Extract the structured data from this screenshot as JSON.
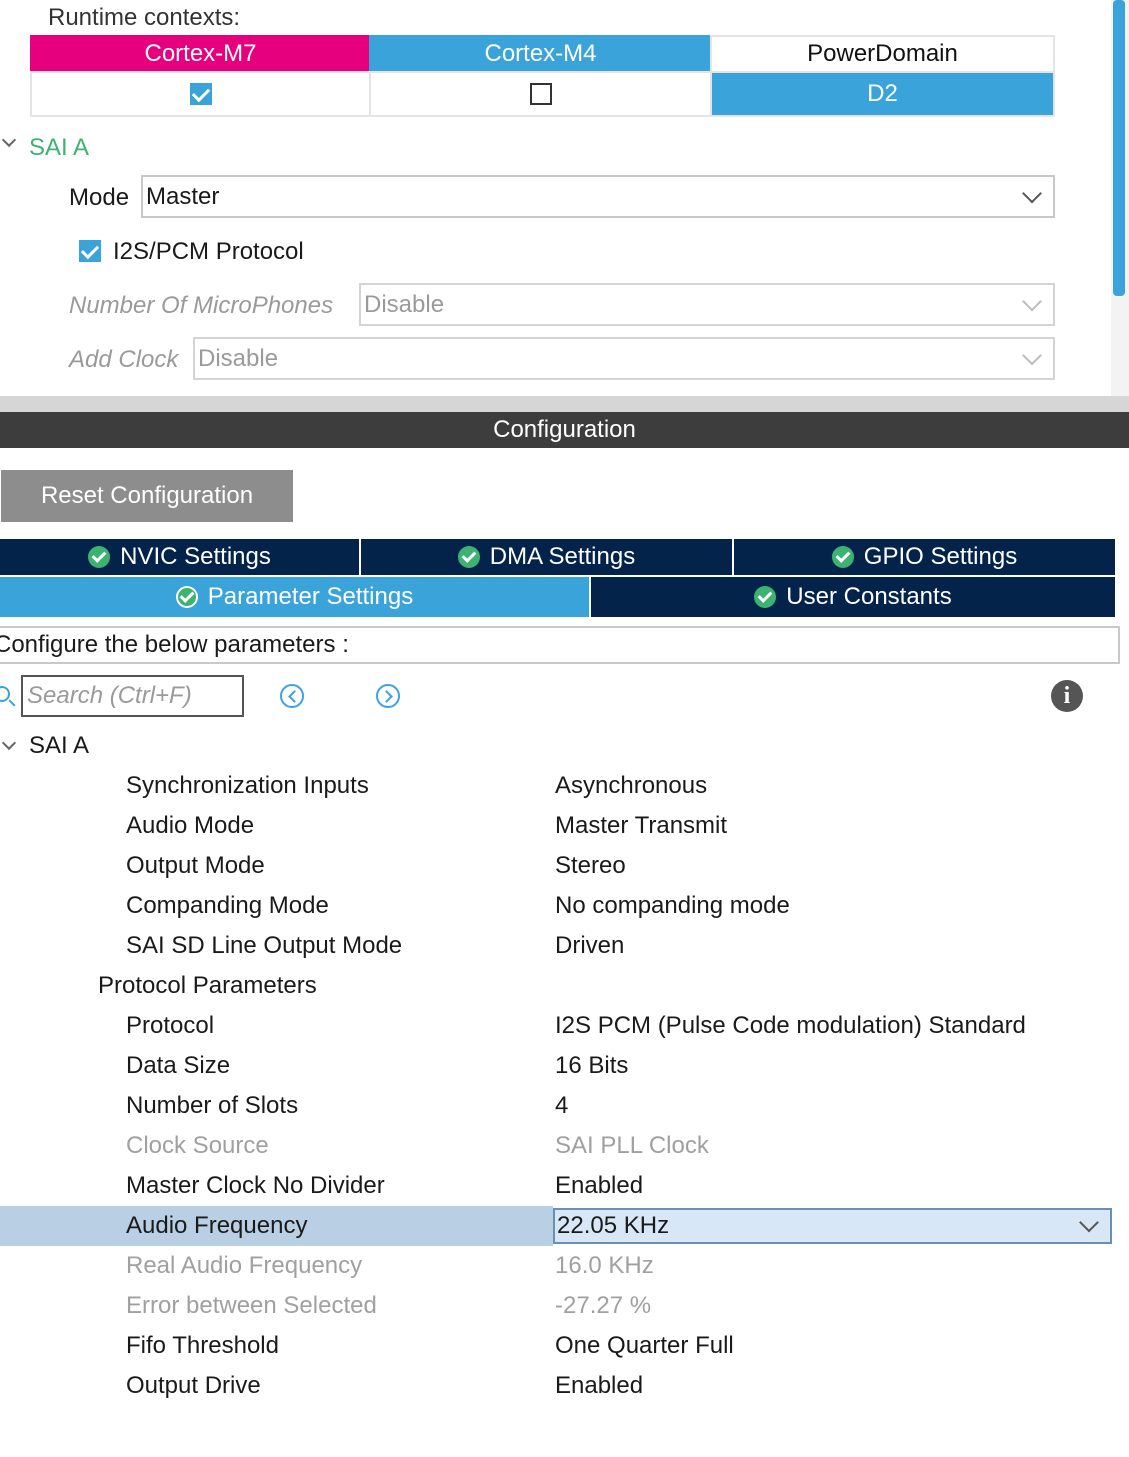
{
  "runtime": {
    "label": "Runtime contexts:",
    "columns": [
      {
        "name": "Cortex-M7",
        "checked": true,
        "color": "#e6007e"
      },
      {
        "name": "Cortex-M4",
        "checked": false,
        "color": "#3aa3d9"
      },
      {
        "name": "PowerDomain",
        "value": "D2"
      }
    ]
  },
  "sai_top": {
    "section": "SAI A",
    "mode_label": "Mode",
    "mode_value": "Master",
    "protocol_label": "I2S/PCM Protocol",
    "protocol_checked": true,
    "mics_label": "Number Of MicroPhones",
    "mics_value": "Disable",
    "clock_label": "Add Clock",
    "clock_value": "Disable"
  },
  "config": {
    "title": "Configuration",
    "reset_label": "Reset Configuration",
    "tabs": {
      "nvic": "NVIC Settings",
      "dma": "DMA Settings",
      "gpio": "GPIO Settings",
      "param": "Parameter Settings",
      "user": "User Constants"
    },
    "hint": "Configure the below parameters :",
    "search_placeholder": "Search (Ctrl+F)"
  },
  "params": {
    "section": "SAI A",
    "rows": [
      {
        "label": "Synchronization Inputs",
        "value": "Asynchronous"
      },
      {
        "label": "Audio Mode",
        "value": "Master Transmit"
      },
      {
        "label": "Output Mode",
        "value": "Stereo"
      },
      {
        "label": "Companding Mode",
        "value": "No companding mode"
      },
      {
        "label": "SAI SD Line Output Mode",
        "value": "Driven"
      },
      {
        "label": "Protocol Parameters",
        "value": ""
      },
      {
        "label": "Protocol",
        "value": "I2S PCM (Pulse Code modulation) Standard"
      },
      {
        "label": "Data Size",
        "value": "16 Bits"
      },
      {
        "label": "Number of Slots",
        "value": "4"
      },
      {
        "label": "Clock Source",
        "value": "SAI PLL Clock"
      },
      {
        "label": "Master Clock No Divider",
        "value": "Enabled"
      },
      {
        "label": "Audio Frequency",
        "value": "22.05 KHz"
      },
      {
        "label": "Real Audio Frequency",
        "value": "16.0 KHz"
      },
      {
        "label": "Error between Selected",
        "value": "-27.27 %"
      },
      {
        "label": "Fifo Threshold",
        "value": "One Quarter Full"
      },
      {
        "label": "Output Drive",
        "value": "Enabled"
      }
    ]
  },
  "colors": {
    "accent": "#3aa3d9",
    "tab_dark": "#03234b",
    "section_green": "#3cb371"
  }
}
